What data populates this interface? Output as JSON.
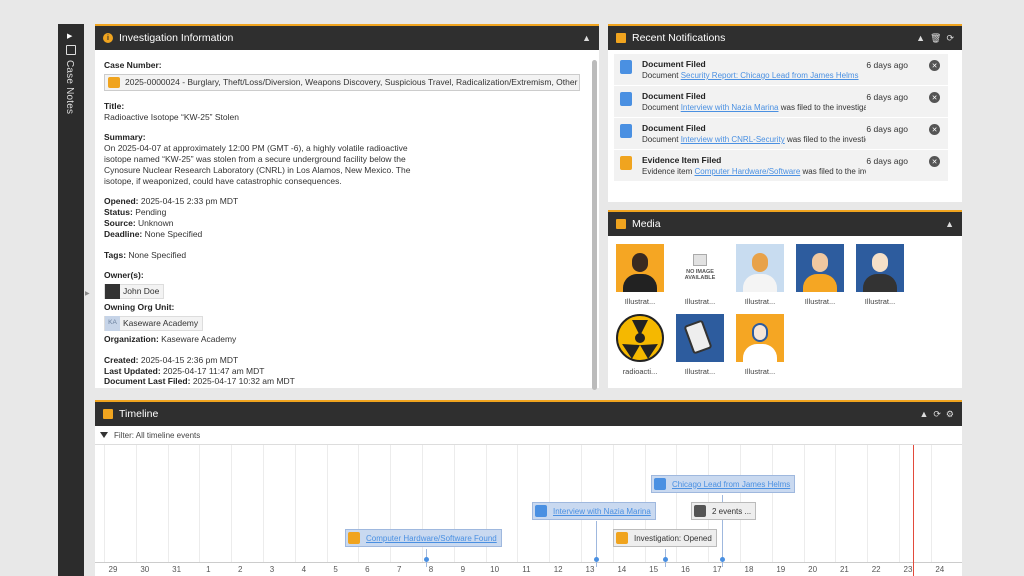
{
  "rail": {
    "label": "Case Notes"
  },
  "investigation": {
    "title": "Investigation Information",
    "case_number_label": "Case Number:",
    "case_number_value": "2025-0000024 - Burglary, Theft/Loss/Diversion, Weapons Discovery, Suspicious Travel, Radicalization/Extremism, Other (describe",
    "title_label": "Title:",
    "title_value": "Radioactive Isotope “KW-25” Stolen",
    "summary_label": "Summary:",
    "summary_lines": [
      "On 2025-04-07 at approximately 12:00 PM (GMT -6), a highly volatile radioactive",
      "isotope named “KW-25” was stolen from a secure underground facility below the",
      "Cynosure Nuclear Research Laboratory (CNRL) in Los Alamos, New Mexico. The",
      "isotope, if weaponized, could have catastrophic consequences."
    ],
    "opened_label": "Opened:",
    "opened_value": "2025-04-15 2:33 pm MDT",
    "status_label": "Status:",
    "status_value": "Pending",
    "source_label": "Source:",
    "source_value": "Unknown",
    "deadline_label": "Deadline:",
    "deadline_value": "None Specified",
    "tags_label": "Tags:",
    "tags_value": "None Specified",
    "owners_label": "Owner(s):",
    "owner_name": "John Doe",
    "org_unit_label": "Owning Org Unit:",
    "org_unit_initials": "KA",
    "org_unit_name": "Kaseware Academy",
    "organization_label": "Organization:",
    "organization_value": "Kaseware Academy",
    "created_label": "Created:",
    "created_value": "2025-04-15 2:36 pm MDT",
    "updated_label": "Last Updated:",
    "updated_value": "2025-04-17 11:47 am MDT",
    "doc_filed_label": "Document Last Filed:",
    "doc_filed_value": "2025-04-17 10:32 am MDT"
  },
  "notifications": {
    "title": "Recent Notifications",
    "items": [
      {
        "title": "Document Filed",
        "prefix": "Document ",
        "link": "Security Report: Chicago Lead from James Helms",
        "suffix": "",
        "ago": "6 days ago"
      },
      {
        "title": "Document Filed",
        "prefix": "Document ",
        "link": "Interview with Nazia Marina",
        "suffix": " was filed to the investigation",
        "ago": "6 days ago"
      },
      {
        "title": "Document Filed",
        "prefix": "Document ",
        "link": "Interview with CNRL-Security",
        "suffix": " was filed to the investigation",
        "ago": "6 days ago"
      },
      {
        "title": "Evidence Item Filed",
        "prefix": "Evidence item ",
        "link": "Computer Hardware/Software",
        "suffix": " was filed to the investigation",
        "ago": "6 days ago"
      }
    ]
  },
  "media": {
    "title": "Media",
    "no_image_line1": "NO IMAGE",
    "no_image_line2": "AVAILABLE",
    "captions": [
      "Illustrat...",
      "Illustrat...",
      "Illustrat...",
      "Illustrat...",
      "Illustrat...",
      "radioacti...",
      "Illustrat...",
      "Illustrat..."
    ]
  },
  "timeline": {
    "title": "Timeline",
    "filter": "Filter: All timeline events",
    "ticks": [
      "29",
      "30",
      "31",
      "1",
      "2",
      "3",
      "4",
      "5",
      "6",
      "7",
      "8",
      "9",
      "10",
      "11",
      "12",
      "13",
      "14",
      "15",
      "16",
      "17",
      "18",
      "19",
      "20",
      "21",
      "22",
      "23",
      "24"
    ],
    "events": {
      "computer": "Computer Hardware/Software Found",
      "interview": "Interview with Nazia Marina",
      "chicago": "Chicago Lead from James Helms",
      "grouped": "2 events ...",
      "opened": "Investigation: Opened"
    }
  },
  "colors": {
    "accent": "#f0a41f",
    "link": "#4a90e2",
    "header": "#2f2f2f"
  }
}
